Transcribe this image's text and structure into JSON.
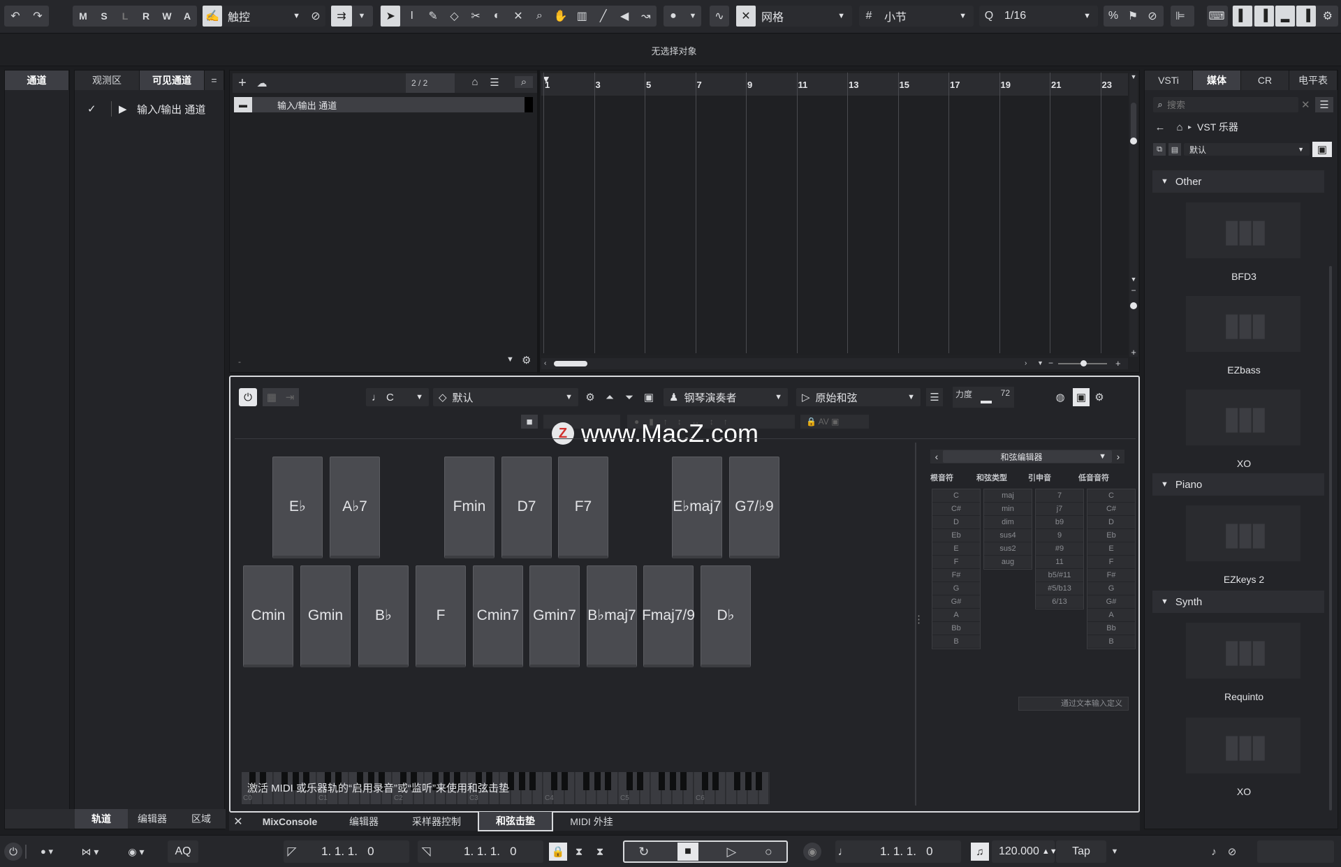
{
  "toolbar": {
    "mode_buttons": [
      "M",
      "S",
      "L",
      "R",
      "W",
      "A"
    ],
    "automation_mode": "触控",
    "grid_type": "网格",
    "grid_unit": "小节",
    "quantize": "1/16"
  },
  "info_line": "无选择对象",
  "left_zone": {
    "tabs": [
      "通道",
      "观测区",
      "可见通道"
    ],
    "tree_item": "输入/输出 通道",
    "bottom_tabs": [
      "轨道",
      "编辑器",
      "区域"
    ]
  },
  "project": {
    "track_count": "2 / 2",
    "track_name": "输入/输出 通道",
    "ruler": [
      "1",
      "3",
      "5",
      "7",
      "9",
      "11",
      "13",
      "15",
      "17",
      "19",
      "21",
      "23"
    ]
  },
  "chord_pads": {
    "key": "C",
    "preset": "默认",
    "player": "钢琴演奏者",
    "voicing": "原始和弦",
    "velocity_label": "力度",
    "velocity_value": "72",
    "watermark": "www.MacZ.com",
    "row1": [
      "E♭",
      "A♭7",
      "Fmin",
      "D7",
      "F7",
      "E♭maj7",
      "G7/♭9"
    ],
    "row2": [
      "Cmin",
      "Gmin",
      "B♭",
      "F",
      "Cmin7",
      "Gmin7",
      "B♭maj7",
      "Fmaj7/9",
      "D♭"
    ],
    "hint": "激活 MIDI 或乐器轨的“启用录音”或“监听”来使用和弦击垫",
    "keyboard_labels": [
      "C0",
      "C1",
      "C2",
      "C3",
      "C4",
      "C5",
      "C6"
    ],
    "editor": {
      "title": "和弦编辑器",
      "col_heads": [
        "根音符",
        "和弦类型",
        "引申音",
        "低音音符"
      ],
      "roots": [
        "C",
        "C#",
        "D",
        "Eb",
        "E",
        "F",
        "F#",
        "G",
        "G#",
        "A",
        "Bb",
        "B"
      ],
      "types": [
        "maj",
        "min",
        "dim",
        "sus4",
        "sus2",
        "aug"
      ],
      "tensions": [
        "7",
        "j7",
        "b9",
        "9",
        "#9",
        "11",
        "b5/#11",
        "#5/b13",
        "6/13"
      ],
      "bass": [
        "C",
        "C#",
        "D",
        "Eb",
        "E",
        "F",
        "F#",
        "G",
        "G#",
        "A",
        "Bb",
        "B"
      ],
      "text_input": "通过文本输入定义"
    }
  },
  "lower_zone_tabs": [
    "MixConsole",
    "编辑器",
    "采样器控制",
    "和弦击垫",
    "MIDI 外挂"
  ],
  "right_zone": {
    "tabs": [
      "VSTi",
      "媒体",
      "CR",
      "电平表"
    ],
    "search_placeholder": "搜索",
    "breadcrumb": "VST 乐器",
    "filter": "默认",
    "groups": [
      {
        "name": "Other",
        "items": [
          "BFD3",
          "EZbass",
          "XO"
        ]
      },
      {
        "name": "Piano",
        "items": [
          "EZkeys 2"
        ]
      },
      {
        "name": "Synth",
        "items": [
          "Requinto",
          "XO"
        ]
      }
    ]
  },
  "transport": {
    "aq": "AQ",
    "left_locator": "1. 1. 1.   0",
    "right_locator": "1. 1. 1.   0",
    "position": "1. 1. 1.   0",
    "tempo": "120.000",
    "tap": "Tap"
  }
}
